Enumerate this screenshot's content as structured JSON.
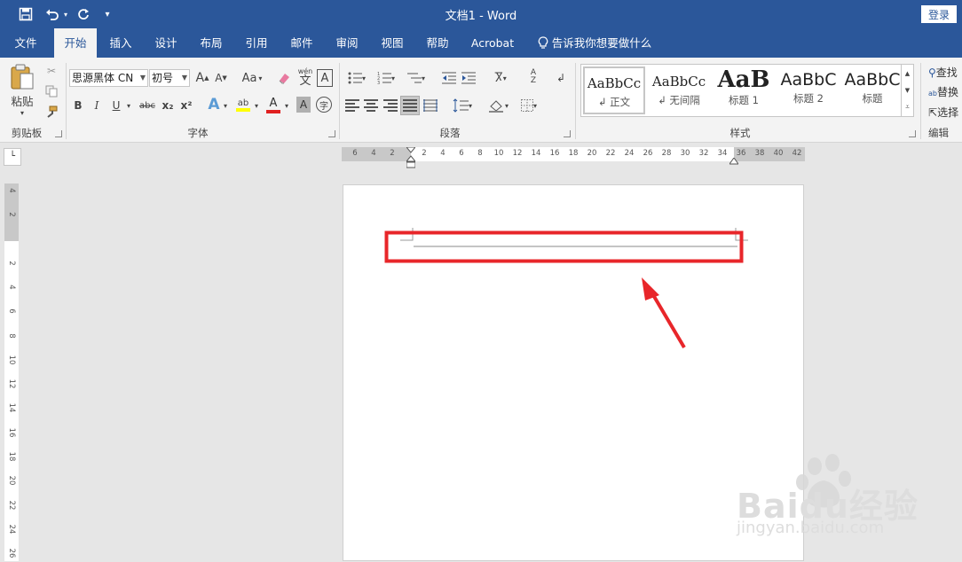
{
  "titlebar": {
    "doc_title": "文档1  -  Word",
    "login": "登录",
    "icons": [
      "save-icon",
      "undo-icon",
      "undo-dropdown-icon",
      "redo-icon",
      "customize-qat-icon"
    ]
  },
  "tabs": [
    "文件",
    "开始",
    "插入",
    "设计",
    "布局",
    "引用",
    "邮件",
    "审阅",
    "视图",
    "帮助",
    "Acrobat"
  ],
  "active_tab": "开始",
  "tell_me": "告诉我你想要做什么",
  "clipboard": {
    "paste": "粘贴",
    "label": "剪贴板"
  },
  "font": {
    "name": "思源黑体 CN",
    "size": "初号",
    "grow": "A",
    "shrink": "A",
    "case": "Aa",
    "phonetic": "wén",
    "phonetic_char": "文",
    "bold": "B",
    "italic": "I",
    "underline": "U",
    "strike": "abc",
    "sub": "x₂",
    "sup": "x²",
    "label": "字体",
    "colors": {
      "highlight": "#ffff00",
      "font_color": "#e02020"
    }
  },
  "paragraph": {
    "label": "段落"
  },
  "styles": {
    "label": "样式",
    "items": [
      {
        "preview": "AaBbCc",
        "name": "↲ 正文"
      },
      {
        "preview": "AaBbCc",
        "name": "↲ 无间隔"
      },
      {
        "preview": "AaB",
        "name": "标题 1"
      },
      {
        "preview": "AaBbC",
        "name": "标题 2"
      },
      {
        "preview": "AaBbC",
        "name": "标题"
      }
    ]
  },
  "editing": {
    "find": "查找",
    "replace": "替换",
    "select": "选择",
    "label": "编辑"
  },
  "ruler": {
    "horizontal": [
      "6",
      "4",
      "2",
      "2",
      "4",
      "6",
      "8",
      "10",
      "12",
      "14",
      "16",
      "18",
      "20",
      "22",
      "24",
      "26",
      "28",
      "30",
      "32",
      "34",
      "36",
      "38",
      "40",
      "42"
    ],
    "vertical": [
      "4",
      "2",
      "2",
      "4",
      "6",
      "8",
      "10",
      "12",
      "14",
      "16",
      "18",
      "20",
      "22",
      "24",
      "26"
    ]
  },
  "annotation": {
    "color": "#e8262a"
  },
  "watermark": {
    "brand": "Baidu经验",
    "url": "jingyan.baidu.com"
  }
}
